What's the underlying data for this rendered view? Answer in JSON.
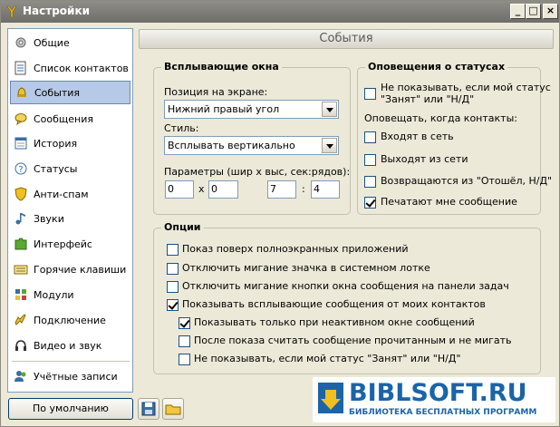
{
  "window": {
    "title": "Настройки"
  },
  "title_buttons": {
    "minimize": "_",
    "maximize": "□",
    "close": "×"
  },
  "sidebar": {
    "items": [
      {
        "label": "Общие",
        "icon": "gear-icon"
      },
      {
        "label": "Список контактов",
        "icon": "contact-list-icon"
      },
      {
        "label": "События",
        "icon": "bell-icon",
        "active": true
      },
      {
        "label": "Сообщения",
        "icon": "message-icon"
      },
      {
        "label": "История",
        "icon": "history-icon"
      },
      {
        "label": "Статусы",
        "icon": "status-icon"
      },
      {
        "label": "Анти-спам",
        "icon": "shield-icon"
      },
      {
        "label": "Звуки",
        "icon": "music-note-icon"
      },
      {
        "label": "Интерфейс",
        "icon": "puzzle-icon"
      },
      {
        "label": "Горячие клавиши",
        "icon": "keyboard-icon"
      },
      {
        "label": "Модули",
        "icon": "modules-icon"
      },
      {
        "label": "Подключение",
        "icon": "plug-icon"
      },
      {
        "label": "Видео и звук",
        "icon": "headphones-icon"
      },
      {
        "label": "Учётные записи",
        "icon": "accounts-icon"
      }
    ]
  },
  "header": {
    "title": "События"
  },
  "popups": {
    "legend": "Всплывающие окна",
    "position_label": "Позиция на экране:",
    "position_value": "Нижний правый угол",
    "style_label": "Стиль:",
    "style_value": "Всплывать вертикально",
    "params_label": "Параметры (шир x выс, сек:рядов):",
    "width": "0",
    "height": "0",
    "seconds": "7",
    "rows": "4",
    "sep_x": "x",
    "sep_colon": ":"
  },
  "status_notify": {
    "legend": "Оповещения о статусах",
    "dont_show_line1": "Не показывать, если мой статус",
    "dont_show_line2": "\"Занят\" или \"Н/Д\"",
    "notify_when": "Оповещать, когда контакты:",
    "items": [
      {
        "label": "Входят в сеть",
        "checked": false
      },
      {
        "label": "Выходят из сети",
        "checked": false
      },
      {
        "label": "Возвращаются из \"Отошёл, Н/Д\"",
        "checked": false
      },
      {
        "label": "Печатают мне сообщение",
        "checked": true
      }
    ]
  },
  "options": {
    "legend": "Опции",
    "items": [
      {
        "label": "Показ поверх полноэкранных приложений",
        "checked": false
      },
      {
        "label": "Отключить мигание значка в системном лотке",
        "checked": false
      },
      {
        "label": "Отключить мигание кнопки окна сообщения на панели задач",
        "checked": false
      },
      {
        "label": "Показывать всплывающие сообщения от моих контактов",
        "checked": true
      },
      {
        "label": "Показывать только при неактивном окне сообщений",
        "checked": true
      },
      {
        "label": "После показа считать сообщение прочитанным и не мигать",
        "checked": false
      },
      {
        "label": "Не показывать, если мой статус \"Занят\" или \"Н/Д\"",
        "checked": false
      }
    ]
  },
  "footer": {
    "default_button": "По умолчанию"
  },
  "watermark": {
    "title": "BIBLSOFT.RU",
    "subtitle": "БИБЛИОТЕКА БЕСПЛАТНЫХ ПРОГРАММ"
  },
  "colors": {
    "accent": "#1b64a8",
    "window_bg": "#ece9d8",
    "titlebar": "#7c7a75",
    "selection": "#b6c9e6"
  }
}
